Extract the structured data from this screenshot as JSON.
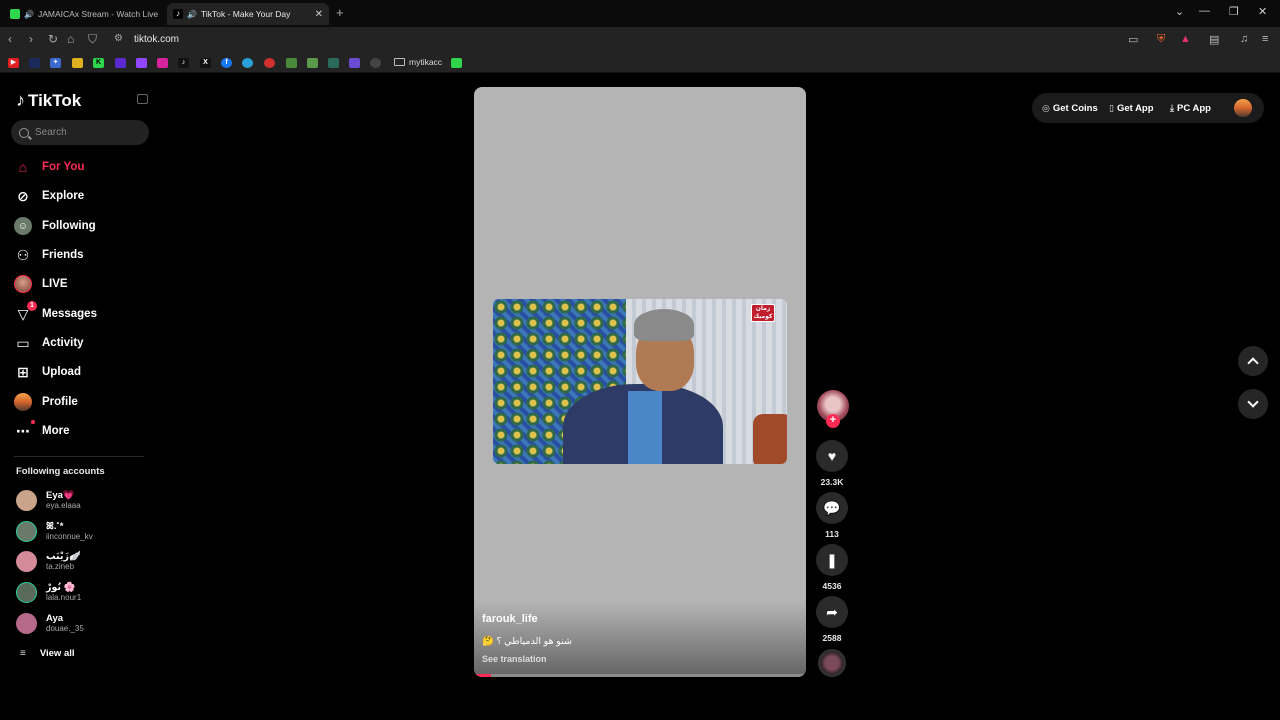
{
  "browser": {
    "tabs": [
      {
        "title": "JAMAICAx Stream - Watch Live o",
        "favicon_color": "#2fd54a",
        "icon": "kick-icon"
      },
      {
        "title": "TikTok - Make Your Day",
        "favicon_color": "#ffffff",
        "icon": "tiktok-icon"
      }
    ],
    "url": "tiktok.com",
    "bookmark_folder": "mytikacc"
  },
  "sidebar": {
    "logo": "TikTok",
    "search_placeholder": "Search",
    "nav": [
      {
        "label": "For You",
        "icon": "home-icon",
        "active": true
      },
      {
        "label": "Explore",
        "icon": "compass-icon"
      },
      {
        "label": "Following",
        "icon": "following-icon"
      },
      {
        "label": "Friends",
        "icon": "friends-icon"
      },
      {
        "label": "LIVE",
        "icon": "live-icon"
      },
      {
        "label": "Messages",
        "icon": "messages-icon",
        "badge": "1"
      },
      {
        "label": "Activity",
        "icon": "activity-icon"
      },
      {
        "label": "Upload",
        "icon": "upload-icon"
      },
      {
        "label": "Profile",
        "icon": "profile-icon"
      },
      {
        "label": "More",
        "icon": "more-icon"
      }
    ],
    "following_title": "Following accounts",
    "accounts": [
      {
        "name": "Eya💗",
        "username": "eya.elaaa",
        "color": "#c9a48a"
      },
      {
        "name": "ꕤ.˚*",
        "username": "iinconnue_kv",
        "color": "#6a7a6a"
      },
      {
        "name": "زَيْنَب🪽",
        "username": "ta.zineb",
        "color": "#d58a9a"
      },
      {
        "name": "نُورْ 🌸",
        "username": "lala.nour1",
        "color": "#5a6a5a"
      },
      {
        "name": "Aya",
        "username": "douae._35",
        "color": "#b56a8a"
      }
    ],
    "view_all": "View all"
  },
  "video": {
    "author": "farouk_life",
    "caption": "شنو هو الدمياطي ؟ 🤔",
    "see_translation": "See translation",
    "channel_logo": "زمان كوميك",
    "progress": 0.05
  },
  "actions": {
    "likes": "23.3K",
    "comments": "113",
    "saves": "4536",
    "shares": "2588"
  },
  "header": {
    "get_coins": "Get Coins",
    "get_app": "Get App",
    "pc_app": "PC App"
  }
}
